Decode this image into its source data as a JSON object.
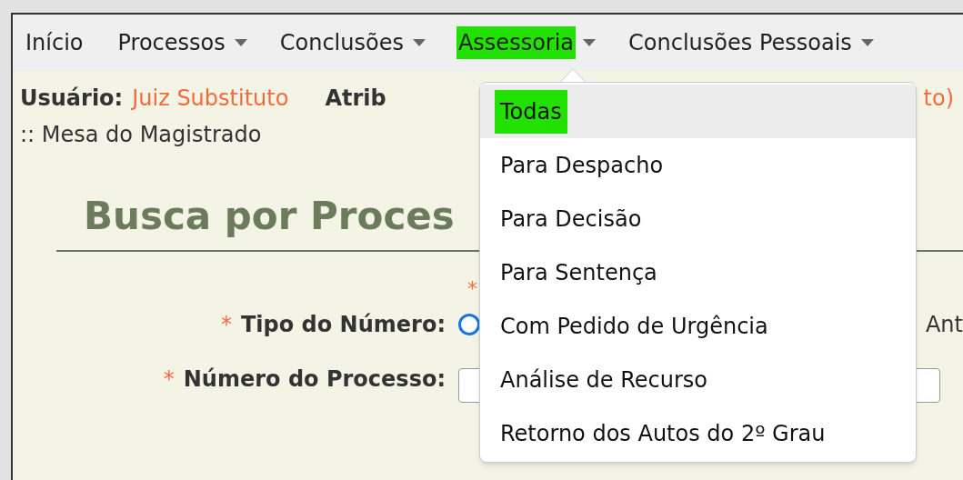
{
  "menu": [
    {
      "label": "Início",
      "dropdown": false,
      "highlighted": false
    },
    {
      "label": "Processos",
      "dropdown": true,
      "highlighted": false
    },
    {
      "label": "Conclusões",
      "dropdown": true,
      "highlighted": false
    },
    {
      "label": "Assessoria",
      "dropdown": true,
      "highlighted": true
    },
    {
      "label": "Conclusões Pessoais",
      "dropdown": true,
      "highlighted": false
    }
  ],
  "dropdown": {
    "items": [
      {
        "label": "Todas",
        "selected": true,
        "highlighted": true
      },
      {
        "label": "Para Despacho",
        "selected": false,
        "highlighted": false
      },
      {
        "label": "Para Decisão",
        "selected": false,
        "highlighted": false
      },
      {
        "label": "Para Sentença",
        "selected": false,
        "highlighted": false
      },
      {
        "label": "Com Pedido de Urgência",
        "selected": false,
        "highlighted": false
      },
      {
        "label": "Análise de Recurso",
        "selected": false,
        "highlighted": false
      },
      {
        "label": "Retorno dos Autos do 2º Grau",
        "selected": false,
        "highlighted": false
      }
    ]
  },
  "user_label": "Usuário:",
  "user_value": "Juiz Substituto",
  "attrib_label": "Atrib",
  "attrib_value": "to)",
  "breadcrumb": ":: Mesa do Magistrado",
  "heading": "Busca por Proces",
  "required_mark": "*",
  "form": [
    {
      "kind": "radio",
      "required": "*",
      "label": "Tipo do Número:",
      "option": "Ant",
      "checked": false
    },
    {
      "kind": "input",
      "required": "*",
      "label": "Número do Processo:"
    }
  ]
}
